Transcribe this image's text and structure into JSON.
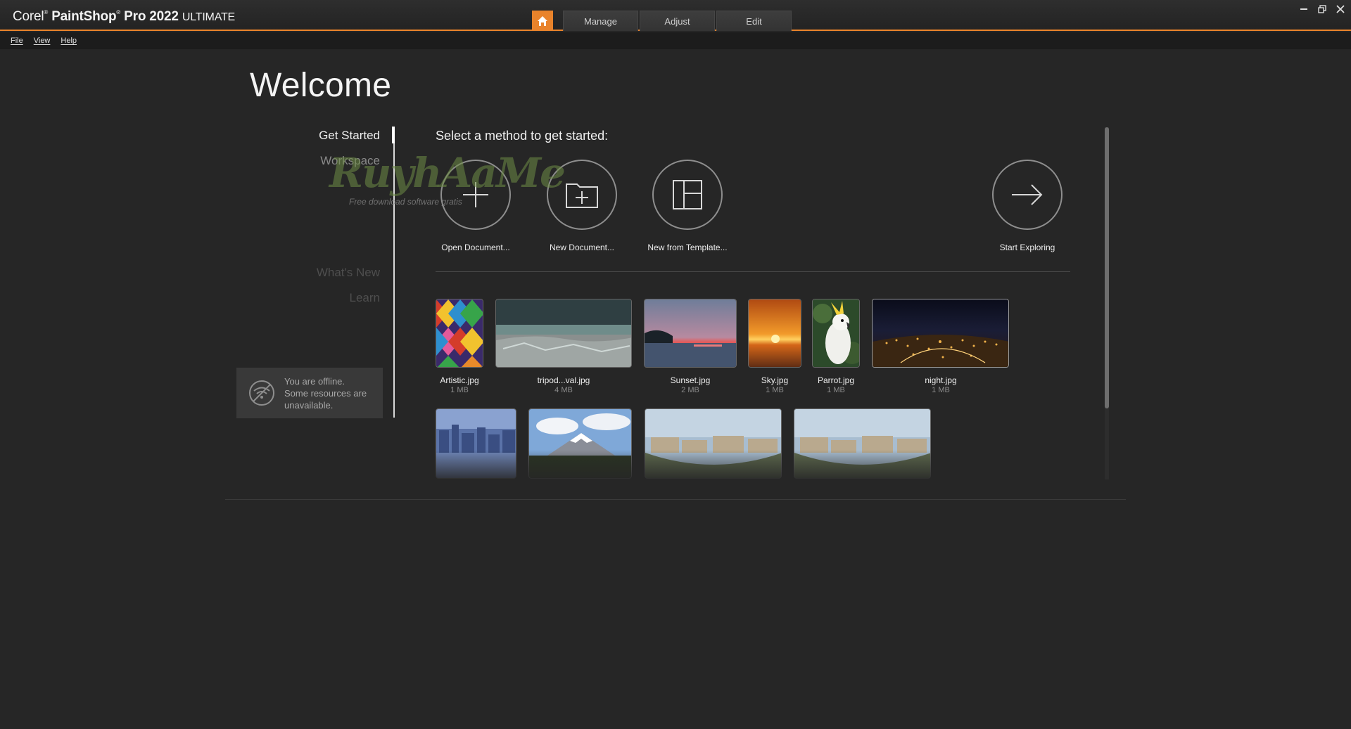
{
  "app": {
    "title_prefix": "Corel",
    "title_product": "PaintShop",
    "title_version": "Pro 2022",
    "title_edition": "ULTIMATE"
  },
  "tabs": [
    {
      "label": "Manage"
    },
    {
      "label": "Adjust"
    },
    {
      "label": "Edit"
    }
  ],
  "menu": [
    {
      "label": "File"
    },
    {
      "label": "View"
    },
    {
      "label": "Help"
    }
  ],
  "welcome": {
    "title": "Welcome",
    "select_heading": "Select a method to get started:"
  },
  "nav": [
    {
      "label": "Get Started",
      "state": "active"
    },
    {
      "label": "Workspace",
      "state": "dim"
    },
    {
      "label": "What's New",
      "state": "faint"
    },
    {
      "label": "Learn",
      "state": "faint"
    }
  ],
  "offline": {
    "text_line1": "You are offline.",
    "text_line2": "Some resources are",
    "text_line3": "unavailable."
  },
  "actions": [
    {
      "label": "Open Document...",
      "icon": "plus-icon"
    },
    {
      "label": "New Document...",
      "icon": "folder-plus-icon"
    },
    {
      "label": "New from Template...",
      "icon": "template-icon"
    },
    {
      "label": "Start Exploring",
      "icon": "arrow-right-icon"
    }
  ],
  "recent_files": [
    {
      "name": "Artistic.jpg",
      "size": "1 MB"
    },
    {
      "name": "tripod...val.jpg",
      "size": "4 MB"
    },
    {
      "name": "Sunset.jpg",
      "size": "2 MB"
    },
    {
      "name": "Sky.jpg",
      "size": "1 MB"
    },
    {
      "name": "Parrot.jpg",
      "size": "1 MB"
    },
    {
      "name": "night.jpg",
      "size": "1 MB"
    }
  ],
  "watermark": {
    "main": "RuyhAaMe",
    "sub": "Free download software gratis"
  },
  "colors": {
    "accent": "#e9832b",
    "background": "#262626",
    "menubar": "#1c1c1c"
  }
}
